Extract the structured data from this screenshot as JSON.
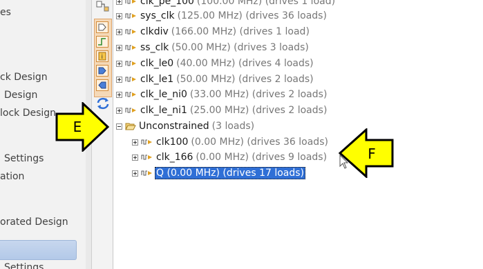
{
  "navigator": {
    "items": [
      {
        "label": "es"
      },
      {
        "label": "ck Design"
      },
      {
        "label": "Design"
      },
      {
        "label": "lock Design"
      },
      {
        "label": "Settings"
      },
      {
        "label": "ation"
      },
      {
        "label": "orated Design"
      },
      {
        "label": "Settings"
      }
    ]
  },
  "toolbar": {
    "icons": [
      "schematic-icon",
      "clock-icon",
      "waveform-icon",
      "info-icon",
      "input-port-icon",
      "output-port-icon",
      "refresh-icon"
    ]
  },
  "tree": {
    "clocks": [
      {
        "name": "clk_pe_100",
        "detail": "(100.00 MHz) (drives 1 load)"
      },
      {
        "name": "sys_clk",
        "detail": "(125.00 MHz) (drives 36 loads)"
      },
      {
        "name": "clkdiv",
        "detail": "(166.00 MHz) (drives 1 load)"
      },
      {
        "name": "ss_clk",
        "detail": "(50.00 MHz) (drives 3 loads)"
      },
      {
        "name": "clk_le0",
        "detail": "(40.00 MHz) (drives 4 loads)"
      },
      {
        "name": "clk_le1",
        "detail": "(50.00 MHz) (drives 2 loads)"
      },
      {
        "name": "clk_le_ni0",
        "detail": "(33.00 MHz) (drives 2 loads)"
      },
      {
        "name": "clk_le_ni1",
        "detail": "(25.00 MHz) (drives 2 loads)"
      }
    ],
    "unconstrained": {
      "name": "Unconstrained",
      "detail": "(3 loads)"
    },
    "unconstrained_children": [
      {
        "name": "clk100",
        "detail": "(0.00 MHz) (drives 36 loads)"
      },
      {
        "name": "clk_166",
        "detail": "(0.00 MHz) (drives 9 loads)"
      },
      {
        "name": "Q",
        "detail": "(0.00 MHz) (drives 17 loads)",
        "selected": true
      }
    ]
  },
  "annotations": {
    "arrow_e": "E",
    "arrow_f": "F",
    "arrow_color": "#ffff00"
  }
}
